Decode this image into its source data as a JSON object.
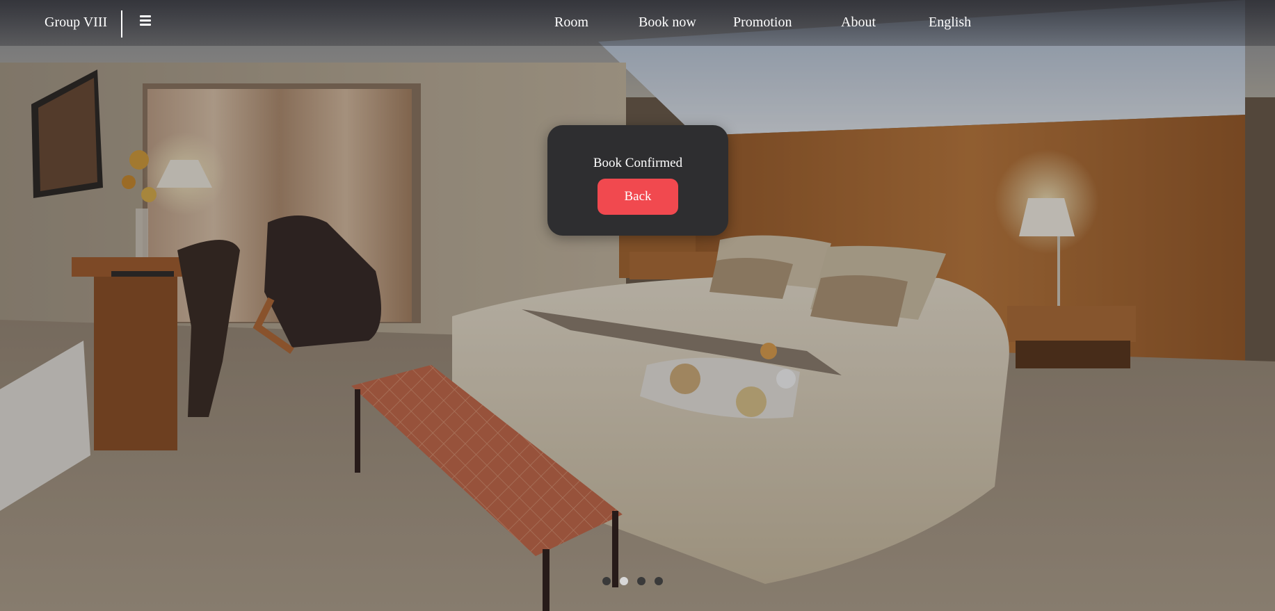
{
  "navbar": {
    "brand": "Group VIII",
    "menu_icon": "hamburger-menu-icon",
    "links": [
      {
        "label": "Room"
      },
      {
        "label": "Book now"
      },
      {
        "label": "Promotion"
      },
      {
        "label": "About"
      },
      {
        "label": "English"
      }
    ]
  },
  "hero": {
    "image": "hotel-bedroom-photo",
    "carousel": {
      "slide_count": 4,
      "active_index": 1
    }
  },
  "modal": {
    "title": "Book Confirmed",
    "button_label": "Back",
    "button_color": "#f1494f",
    "background_color": "#2e2e30"
  }
}
